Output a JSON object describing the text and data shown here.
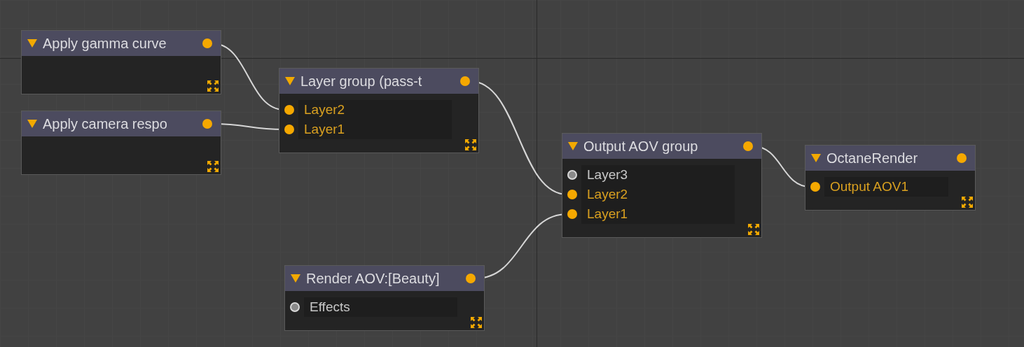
{
  "nodes": [
    {
      "title": "Apply gamma curve"
    },
    {
      "title": "Apply camera respo"
    },
    {
      "title": "Layer group (pass-t",
      "inputs": [
        {
          "label": "Layer2",
          "connected": true
        },
        {
          "label": "Layer1",
          "connected": true
        }
      ]
    },
    {
      "title": "Output AOV group",
      "inputs": [
        {
          "label": "Layer3",
          "connected": false
        },
        {
          "label": "Layer2",
          "connected": true
        },
        {
          "label": "Layer1",
          "connected": true
        }
      ]
    },
    {
      "title": "OctaneRender",
      "inputs": [
        {
          "label": "Output AOV1",
          "connected": true
        }
      ]
    },
    {
      "title": "Render AOV:[Beauty]",
      "inputs": [
        {
          "label": "Effects",
          "connected": false
        }
      ]
    }
  ]
}
